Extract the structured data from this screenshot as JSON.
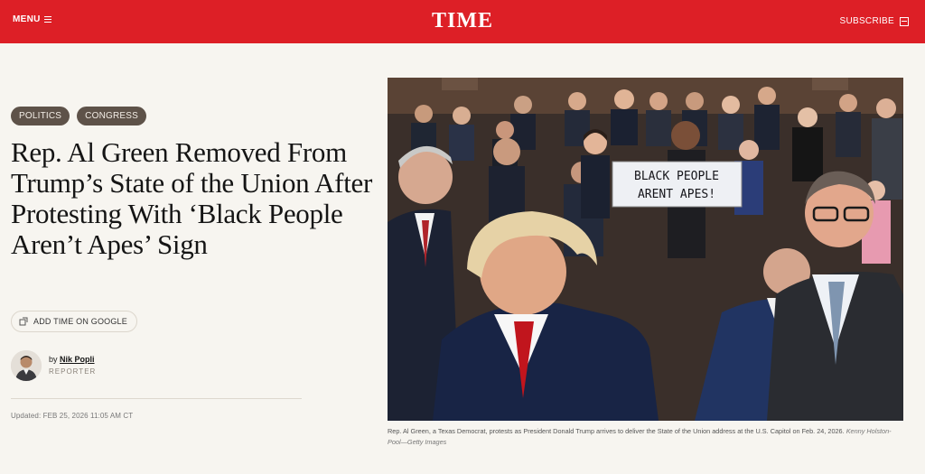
{
  "header": {
    "menu_label": "MENU",
    "logo": "TIME",
    "subscribe_label": "SUBSCRIBE"
  },
  "tags": [
    "POLITICS",
    "CONGRESS"
  ],
  "article": {
    "headline": "Rep. Al Green Removed From Trump’s State of the Union After Protesting With ‘Black People Aren’t Apes’ Sign",
    "google_button": "ADD TIME ON GOOGLE",
    "byline_prefix": "by",
    "author": "Nik Popli",
    "author_role": "REPORTER",
    "updated": "Updated: FEB 25, 2026 11:05 AM CT"
  },
  "photo": {
    "sign_line1": "BLACK PEOPLE",
    "sign_line2": "ARENT APES!",
    "caption": "Rep. Al Green, a Texas Democrat, protests as President Donald Trump arrives to deliver the State of the Union address at the U.S. Capitol on Feb. 24, 2026.",
    "credit": "Kenny Holston-Pool—Getty Images"
  },
  "colors": {
    "brand_red": "#dd1f26",
    "tag_bg": "#5e5249",
    "page_bg": "#f7f5f0"
  }
}
